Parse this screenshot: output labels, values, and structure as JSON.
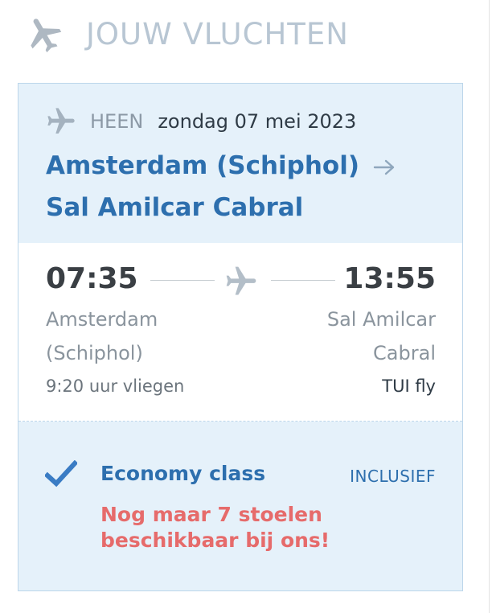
{
  "header": {
    "title": "JOUW VLUCHTEN",
    "icon": "airplane-icon"
  },
  "flight": {
    "direction_label": "HEEN",
    "date": "zondag 07 mei 2023",
    "origin": "Amsterdam (Schiphol)",
    "destination": "Sal Amilcar Cabral",
    "departure_time": "07:35",
    "arrival_time": "13:55",
    "departure_city_line1": "Amsterdam",
    "departure_city_line2": "(Schiphol)",
    "arrival_city_line1": "Sal Amilcar",
    "arrival_city_line2": "Cabral",
    "duration": "9:20 uur vliegen",
    "carrier": "TUI fly"
  },
  "fare": {
    "class_name": "Economy class",
    "included_label": "INCLUSIEF",
    "availability_line1": "Nog maar 7 stoelen",
    "availability_line2": "beschikbaar bij ons!"
  },
  "colors": {
    "accent_blue": "#2d6fae",
    "panel_bg": "#e5f1fa",
    "warning_red": "#e66b6b",
    "muted_grey": "#b8c6d3"
  }
}
